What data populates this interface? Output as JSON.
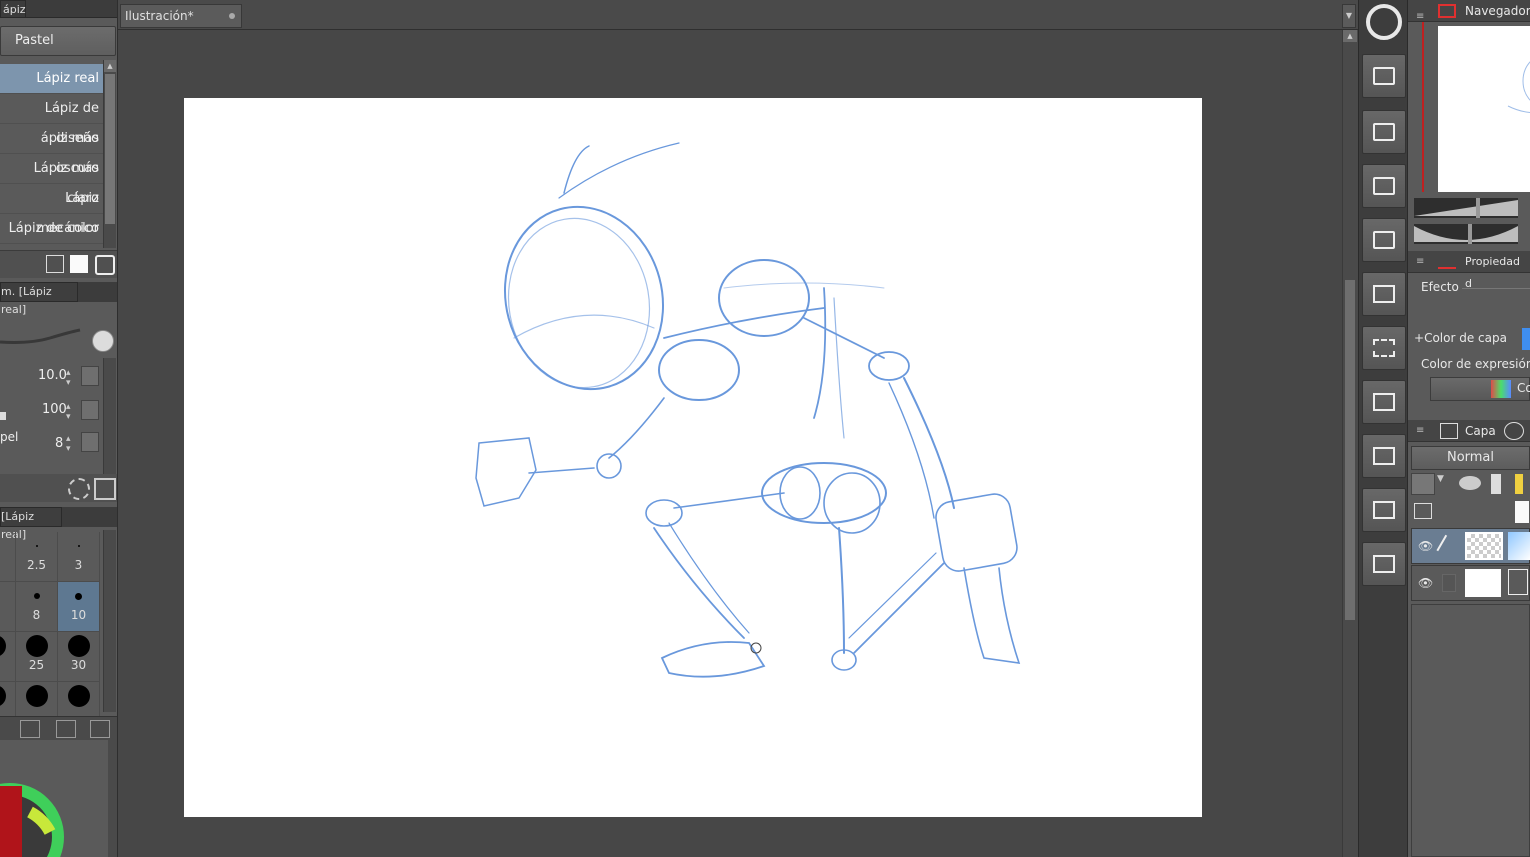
{
  "left_panel": {
    "subtool_header": "ápiz]",
    "group_button": "Pastel",
    "subtools": [
      "Lápiz real",
      "Lápiz de diseño",
      "ápiz más oscuro",
      "Lápiz más claro",
      "Lápiz mecánico",
      "Lápiz de color"
    ],
    "tool_property_tab": "m. [Lápiz real]",
    "size_value": "10.0",
    "opacity_value": "100",
    "paper_label": "pel",
    "paper_value": "8",
    "brush_size_tab": "[Lápiz real]",
    "brush_sizes": [
      {
        "label": "",
        "dot": 0
      },
      {
        "label": "2.5",
        "dot": 2
      },
      {
        "label": "3",
        "dot": 2
      },
      {
        "label": "",
        "dot": 0
      },
      {
        "label": "8",
        "dot": 6
      },
      {
        "label": "10",
        "dot": 7
      },
      {
        "label": "",
        "dot": 22
      },
      {
        "label": "25",
        "dot": 22
      },
      {
        "label": "30",
        "dot": 22
      },
      {
        "label": "",
        "dot": 22
      },
      {
        "label": "",
        "dot": 22
      },
      {
        "label": "",
        "dot": 22
      }
    ]
  },
  "canvas": {
    "document_tab": "Ilustración*",
    "stroke_color": "#4f86d6"
  },
  "right_panel": {
    "navigator_title": "Navegador",
    "layer_property_title": "Propiedad d",
    "effect_label": "Efecto",
    "layer_color_label": "Color de capa",
    "expression_color_label": "Color de expresión",
    "expression_color_btn": "Co",
    "layer_panel_title": "Capa",
    "blend_mode": "Normal"
  },
  "colors": {
    "selected_subtool": "#7d95ad",
    "selected_brush_size": "#5e7891",
    "accent_blue": "#3f8ef0"
  }
}
